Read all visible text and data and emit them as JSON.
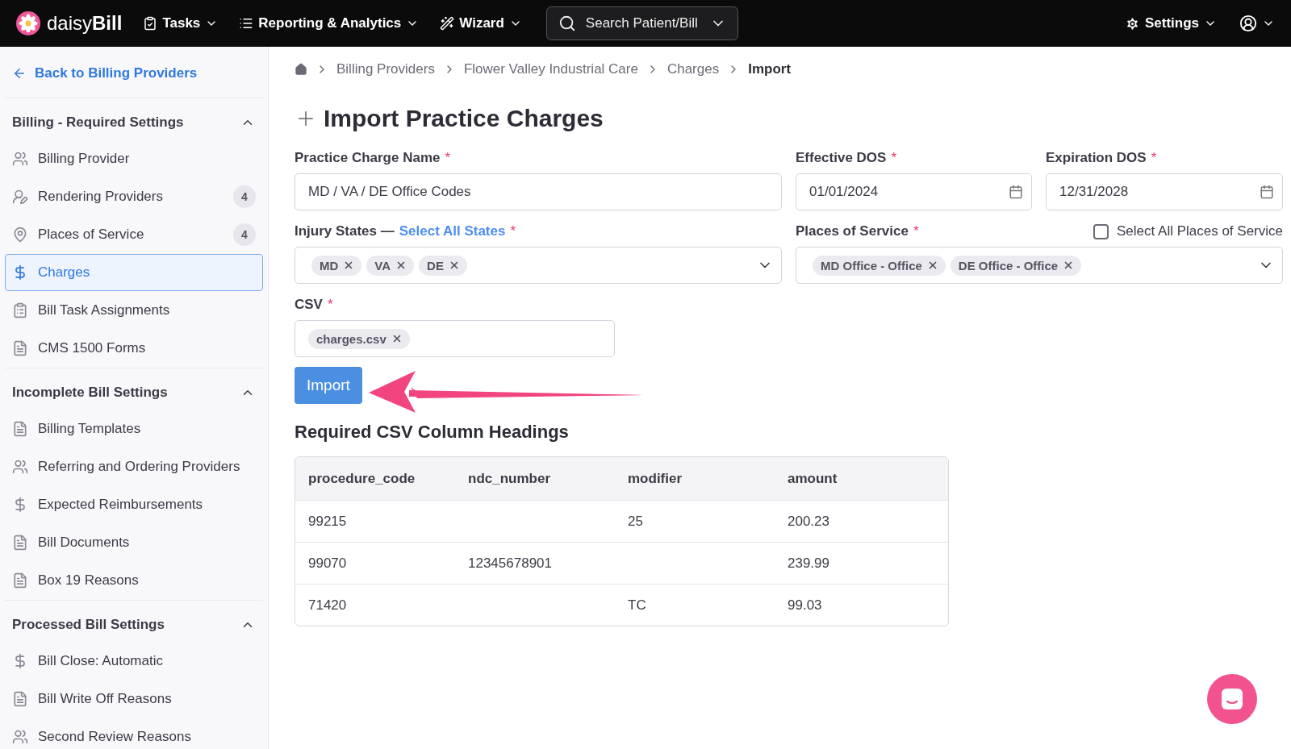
{
  "topbar": {
    "logo": {
      "light": "daisy",
      "bold": "Bill"
    },
    "menus": [
      {
        "kind": "tasks",
        "label": "Tasks"
      },
      {
        "kind": "reports",
        "label": "Reporting & Analytics"
      },
      {
        "kind": "wizard",
        "label": "Wizard"
      }
    ],
    "search": {
      "placeholder": "Search Patient/Bill"
    },
    "settings": {
      "label": "Settings"
    }
  },
  "sidebar": {
    "back_link": "Back to Billing Providers",
    "sections": [
      {
        "title": "Billing - Required Settings",
        "expanded": true,
        "items": [
          {
            "kind": "people",
            "label": "Billing Provider",
            "selected": false
          },
          {
            "kind": "speaker",
            "label": "Rendering Providers",
            "count": "4",
            "selected": false
          },
          {
            "kind": "pin",
            "label": "Places of Service",
            "count": "4",
            "selected": false
          },
          {
            "kind": "dollar",
            "label": "Charges",
            "selected": true
          },
          {
            "kind": "task",
            "label": "Bill Task Assignments",
            "selected": false
          },
          {
            "kind": "document",
            "label": "CMS 1500 Forms",
            "selected": false
          }
        ]
      },
      {
        "title": "Incomplete Bill Settings",
        "expanded": true,
        "items": [
          {
            "kind": "document",
            "label": "Billing Templates",
            "selected": false
          },
          {
            "kind": "people",
            "label": "Referring and Ordering Providers",
            "selected": false
          },
          {
            "kind": "dollar",
            "label": "Expected Reimbursements",
            "selected": false
          },
          {
            "kind": "document",
            "label": "Bill Documents",
            "selected": false
          },
          {
            "kind": "document",
            "label": "Box 19 Reasons",
            "selected": false
          }
        ]
      },
      {
        "title": "Processed Bill Settings",
        "expanded": true,
        "items": [
          {
            "kind": "dollar",
            "label": "Bill Close: Automatic",
            "selected": false
          },
          {
            "kind": "document",
            "label": "Bill Write Off Reasons",
            "selected": false
          },
          {
            "kind": "people",
            "label": "Second Review Reasons",
            "selected": false
          }
        ]
      }
    ]
  },
  "breadcrumb": [
    "Billing Providers",
    "Flower Valley Industrial Care",
    "Charges",
    "Import"
  ],
  "page_title": "Import Practice Charges",
  "form": {
    "charge_name": {
      "label": "Practice Charge Name",
      "required_mark": "*",
      "value": "MD / VA / DE Office Codes"
    },
    "effective_dos": {
      "label": "Effective DOS",
      "required_mark": "*",
      "value": "01/01/2024"
    },
    "expiration_dos": {
      "label": "Expiration DOS",
      "required_mark": "*",
      "value": "12/31/2028"
    },
    "injury_states": {
      "label": "Injury States —",
      "link": "Select All States",
      "required_mark": "*",
      "chips": [
        "MD",
        "VA",
        "DE"
      ]
    },
    "places_of_service": {
      "label": "Places of Service",
      "required_mark": "*",
      "select_all": {
        "label": "Select All Places of Service",
        "checked": false
      },
      "chips": [
        "MD Office - Office",
        "DE Office - Office"
      ]
    },
    "csv": {
      "label": "CSV",
      "required_mark": "*",
      "chips": [
        "charges.csv"
      ]
    },
    "import_button": "Import"
  },
  "headings": {
    "title": "Required CSV Column Headings",
    "columns": [
      "procedure_code",
      "ndc_number",
      "modifier",
      "amount"
    ],
    "rows": [
      [
        "99215",
        "",
        "25",
        "200.23"
      ],
      [
        "99070",
        "12345678901",
        "",
        "239.99"
      ],
      [
        "71420",
        "",
        "TC",
        "99.03"
      ]
    ]
  }
}
